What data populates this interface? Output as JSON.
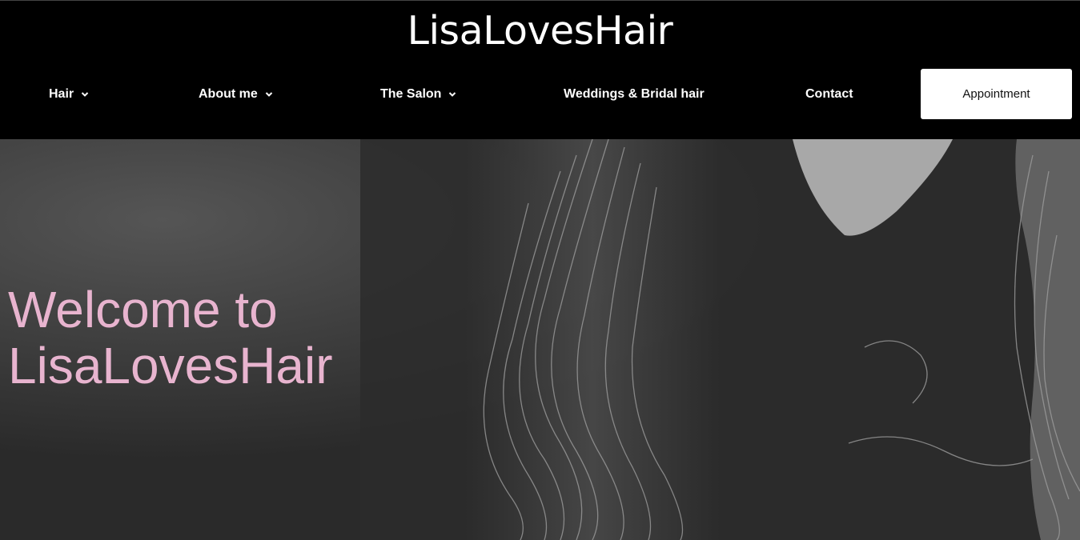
{
  "header": {
    "logo": "LisaLovesHair"
  },
  "nav": {
    "items": [
      {
        "label": "Hair",
        "dropdown": true
      },
      {
        "label": "About me",
        "dropdown": true
      },
      {
        "label": "The Salon",
        "dropdown": true
      },
      {
        "label": "Weddings & Bridal hair",
        "dropdown": false
      },
      {
        "label": "Contact",
        "dropdown": false
      }
    ],
    "appointment_label": "Appointment"
  },
  "hero": {
    "title_line1": "Welcome to",
    "title_line2": "LisaLovesHair",
    "title_color": "#e8b4cf"
  },
  "colors": {
    "header_bg": "#000000",
    "hero_bg": "#2d2d2d",
    "button_bg": "#ffffff"
  }
}
